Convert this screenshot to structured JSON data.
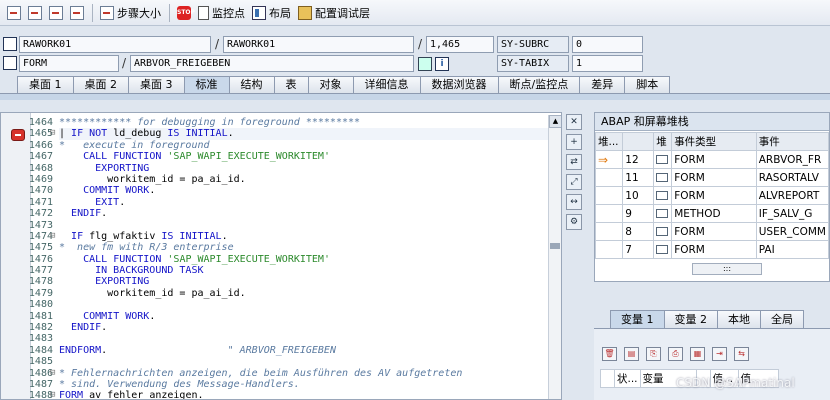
{
  "toolbar": {
    "step_size_label": "步骤大小",
    "watchpoint_label": "监控点",
    "layout_label": "布局",
    "config_layer_label": "配置调试层",
    "stop_icon_text": "STOP"
  },
  "fields": {
    "row1": {
      "left_value": "RAWORK01",
      "right_value": "RAWORK01",
      "line_value": "1,465",
      "sys_name": "SY-SUBRC",
      "sys_value": "0"
    },
    "row2": {
      "left_value": "FORM",
      "right_value": "ARBVOR_FREIGEBEN",
      "sys_name": "SY-TABIX",
      "sys_value": "1"
    }
  },
  "tabs": [
    "桌面 1",
    "桌面 2",
    "桌面 3",
    "标准",
    "结构",
    "表",
    "对象",
    "详细信息",
    "数据浏览器",
    "断点/监控点",
    "差异",
    "脚本"
  ],
  "active_tab": "标准",
  "code_lines": [
    {
      "n": "1464",
      "fold": "",
      "parts": [
        [
          "cmt",
          "************ for debugging in foreground *********"
        ]
      ]
    },
    {
      "n": "1465",
      "fold": "⊟",
      "parts": [
        [
          "plain",
          "| "
        ],
        [
          "kw",
          "IF NOT"
        ],
        [
          "plain",
          " ld_debug "
        ],
        [
          "kw",
          "IS INITIAL"
        ],
        [
          "plain",
          "."
        ]
      ]
    },
    {
      "n": "1466",
      "fold": "",
      "parts": [
        [
          "cmt",
          "*   execute in foreground"
        ]
      ]
    },
    {
      "n": "1467",
      "fold": "",
      "parts": [
        [
          "plain",
          "    "
        ],
        [
          "kw",
          "CALL FUNCTION"
        ],
        [
          "plain",
          " "
        ],
        [
          "str",
          "'SAP_WAPI_EXECUTE_WORKITEM'"
        ]
      ]
    },
    {
      "n": "1468",
      "fold": "",
      "parts": [
        [
          "plain",
          "      "
        ],
        [
          "kw",
          "EXPORTING"
        ]
      ]
    },
    {
      "n": "1469",
      "fold": "",
      "parts": [
        [
          "plain",
          "        workitem_id = pa_ai_id."
        ]
      ]
    },
    {
      "n": "1470",
      "fold": "",
      "parts": [
        [
          "plain",
          "    "
        ],
        [
          "kw",
          "COMMIT WORK"
        ],
        [
          "plain",
          "."
        ]
      ]
    },
    {
      "n": "1471",
      "fold": "",
      "parts": [
        [
          "plain",
          "      "
        ],
        [
          "kw",
          "EXIT"
        ],
        [
          "plain",
          "."
        ]
      ]
    },
    {
      "n": "1472",
      "fold": "",
      "parts": [
        [
          "plain",
          "  "
        ],
        [
          "kw",
          "ENDIF"
        ],
        [
          "plain",
          "."
        ]
      ]
    },
    {
      "n": "1473",
      "fold": "",
      "parts": [
        [
          "plain",
          ""
        ]
      ]
    },
    {
      "n": "1474",
      "fold": "⊟",
      "parts": [
        [
          "plain",
          "  "
        ],
        [
          "kw",
          "IF"
        ],
        [
          "plain",
          " flg_wfaktiv "
        ],
        [
          "kw",
          "IS INITIAL"
        ],
        [
          "plain",
          "."
        ]
      ]
    },
    {
      "n": "1475",
      "fold": "",
      "parts": [
        [
          "cmt",
          "*  new fm with R/3 enterprise"
        ]
      ]
    },
    {
      "n": "1476",
      "fold": "",
      "parts": [
        [
          "plain",
          "    "
        ],
        [
          "kw",
          "CALL FUNCTION"
        ],
        [
          "plain",
          " "
        ],
        [
          "str",
          "'SAP_WAPI_EXECUTE_WORKITEM'"
        ]
      ]
    },
    {
      "n": "1477",
      "fold": "",
      "parts": [
        [
          "plain",
          "      "
        ],
        [
          "kw",
          "IN BACKGROUND TASK"
        ]
      ]
    },
    {
      "n": "1478",
      "fold": "",
      "parts": [
        [
          "plain",
          "      "
        ],
        [
          "kw",
          "EXPORTING"
        ]
      ]
    },
    {
      "n": "1479",
      "fold": "",
      "parts": [
        [
          "plain",
          "        workitem_id = pa_ai_id."
        ]
      ]
    },
    {
      "n": "1480",
      "fold": "",
      "parts": [
        [
          "plain",
          ""
        ]
      ]
    },
    {
      "n": "1481",
      "fold": "",
      "parts": [
        [
          "plain",
          "    "
        ],
        [
          "kw",
          "COMMIT WORK"
        ],
        [
          "plain",
          "."
        ]
      ]
    },
    {
      "n": "1482",
      "fold": "",
      "parts": [
        [
          "plain",
          "  "
        ],
        [
          "kw",
          "ENDIF"
        ],
        [
          "plain",
          "."
        ]
      ]
    },
    {
      "n": "1483",
      "fold": "",
      "parts": [
        [
          "plain",
          ""
        ]
      ]
    },
    {
      "n": "1484",
      "fold": "",
      "parts": [
        [
          "kw",
          "ENDFORM"
        ],
        [
          "plain",
          ".                    "
        ],
        [
          "cmt",
          "\" ARBVOR_FREIGEBEN"
        ]
      ]
    },
    {
      "n": "1485",
      "fold": "",
      "parts": [
        [
          "plain",
          ""
        ]
      ]
    },
    {
      "n": "1486",
      "fold": "⊟",
      "parts": [
        [
          "cmt",
          "* Fehlernachrichten anzeigen, die beim Ausführen des AV aufgetreten"
        ]
      ]
    },
    {
      "n": "1487",
      "fold": "",
      "parts": [
        [
          "cmt",
          "* sind. Verwendung des Message-Handlers."
        ]
      ]
    },
    {
      "n": "1488",
      "fold": "⊟",
      "parts": [
        [
          "kw",
          "FORM"
        ],
        [
          "plain",
          " av_fehler_anzeigen."
        ]
      ]
    }
  ],
  "stack": {
    "title": "ABAP 和屏幕堆栈",
    "headers": [
      "堆...",
      "",
      "堆",
      "事件类型",
      "事件"
    ],
    "rows": [
      {
        "current": true,
        "level": "12",
        "type": "FORM",
        "event": "ARBVOR_FR"
      },
      {
        "current": false,
        "level": "11",
        "type": "FORM",
        "event": "RASORTALV"
      },
      {
        "current": false,
        "level": "10",
        "type": "FORM",
        "event": "ALVREPORT"
      },
      {
        "current": false,
        "level": "9",
        "type": "METHOD",
        "event": "IF_SALV_G"
      },
      {
        "current": false,
        "level": "8",
        "type": "FORM",
        "event": "USER_COMM"
      },
      {
        "current": false,
        "level": "7",
        "type": "FORM",
        "event": "PAI"
      }
    ]
  },
  "vars": {
    "tabs": [
      "变量 1",
      "变量 2",
      "本地",
      "全局"
    ],
    "active_tab": "变量 1",
    "headers": [
      "",
      "状...",
      "变量",
      "",
      "值...",
      "值"
    ]
  },
  "watermark": "CSDN @SAPmatinal"
}
